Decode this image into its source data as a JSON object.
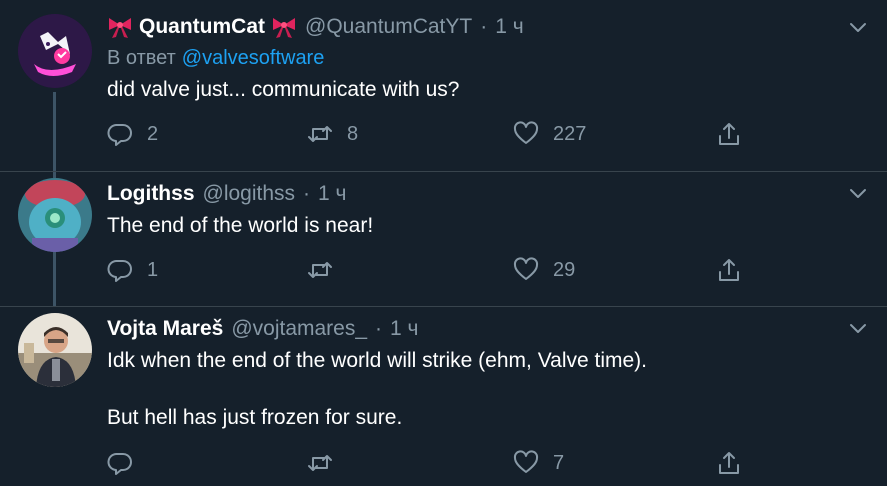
{
  "colors": {
    "background": "#15202b",
    "secondary_text": "#8899a6",
    "link": "#1da1f2",
    "divider": "#38444d",
    "bow": "#e0245e"
  },
  "tweets": [
    {
      "name": "QuantumCat",
      "name_decoration_icon": "ribbon-bow-icon",
      "handle": "@QuantumCatYT",
      "separator": "·",
      "time": "1 ч",
      "reply_to_prefix": "В ответ",
      "reply_to_handle": "@valvesoftware",
      "text": "did valve just... communicate with us?",
      "replies": "2",
      "retweets": "8",
      "likes": "227"
    },
    {
      "name": "Logithss",
      "handle": "@logithss",
      "separator": "·",
      "time": "1 ч",
      "text": "The end of the world is near!",
      "replies": "1",
      "retweets": "",
      "likes": "29"
    },
    {
      "name": "Vojta Mareš",
      "handle": "@vojtamares_",
      "separator": "·",
      "time": "1 ч",
      "text_line1": "Idk when the end of the world will strike (ehm, Valve time).",
      "text_line2": "But hell has just frozen for sure.",
      "replies": "",
      "retweets": "",
      "likes": "7"
    }
  ]
}
